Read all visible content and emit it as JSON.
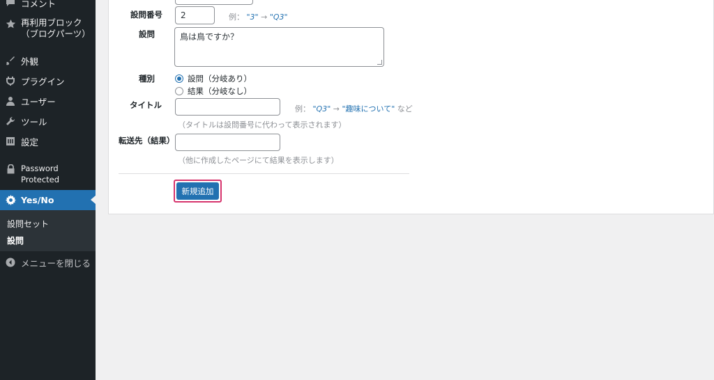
{
  "sidebar": {
    "items": [
      {
        "label": "コメント",
        "icon": "comment-icon"
      },
      {
        "label": "再利用ブロック",
        "label2": "（ブログパーツ）",
        "icon": "star-icon"
      },
      {
        "label": "外観",
        "icon": "paintbrush-icon"
      },
      {
        "label": "プラグイン",
        "icon": "plugin-icon"
      },
      {
        "label": "ユーザー",
        "icon": "user-icon"
      },
      {
        "label": "ツール",
        "icon": "wrench-icon"
      },
      {
        "label": "設定",
        "icon": "settings-icon"
      },
      {
        "label": "Password",
        "label2": "Protected",
        "icon": "lock-icon"
      },
      {
        "label": "Yes/No",
        "icon": "gear-icon",
        "active": true
      }
    ],
    "submenu": [
      {
        "label": "設問セット"
      },
      {
        "label": "設問",
        "current": true
      }
    ],
    "collapse_label": "メニューを閉じる"
  },
  "form": {
    "number": {
      "label": "設問番号",
      "value": "2",
      "hint_prefix": "例：",
      "hint_a": "\"3\"",
      "hint_arrow": " → ",
      "hint_b": "\"Q3\""
    },
    "question": {
      "label": "設問",
      "value": "鳥は鳥ですか？"
    },
    "type": {
      "label": "種別",
      "options": [
        {
          "label": "設問（分岐あり）",
          "checked": true
        },
        {
          "label": "結果（分岐なし）",
          "checked": false
        }
      ]
    },
    "title": {
      "label": "タイトル",
      "value": "",
      "hint_prefix": "例：",
      "hint_a": "\"Q3\"",
      "hint_arrow": " → ",
      "hint_b": "\"趣味について\"",
      "hint_suffix": "など",
      "note": "（タイトルは設問番号に代わって表示されます）"
    },
    "redirect": {
      "label": "転送先（結果）",
      "value": "",
      "note": "（他に作成したページにて結果を表示します）"
    },
    "submit_label": "新規追加"
  },
  "colors": {
    "accent": "#2271b1",
    "sidebar_bg": "#1d2327",
    "highlight_frame": "#d6336c"
  }
}
